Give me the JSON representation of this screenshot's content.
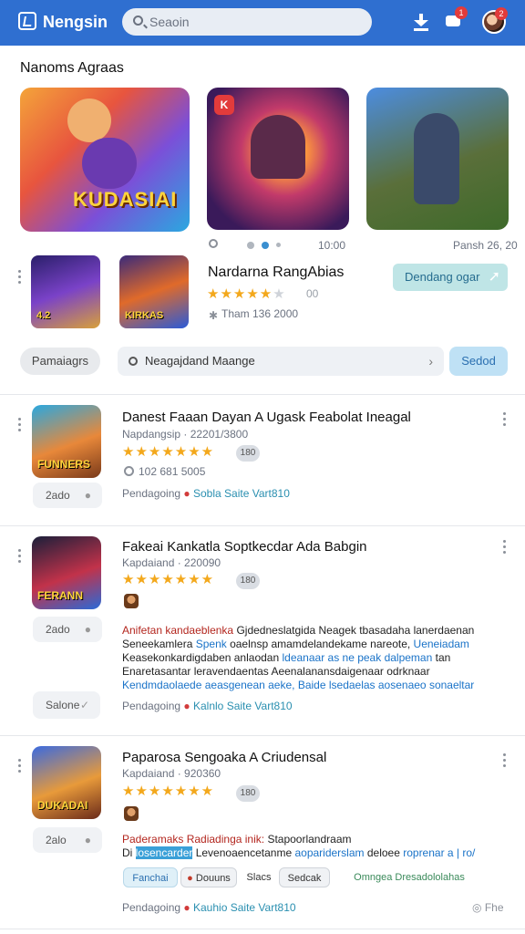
{
  "app": {
    "name": "Nengsin"
  },
  "search": {
    "placeholder": "Seaoin"
  },
  "header": {
    "notif_count": "1",
    "avatar_count": "2"
  },
  "colors": {
    "topbar": "#2f6fd0",
    "accent": "#2a8fb0",
    "star": "#f3a81c",
    "badge": "#e23b3b"
  },
  "section": {
    "title": "Nanoms Agraas"
  },
  "featured": [
    {
      "label": "KUDASIAI",
      "icon": "game-art"
    },
    {
      "label": "",
      "icon": "game-art",
      "badge": "K"
    },
    {
      "label": "",
      "icon": "game-art"
    }
  ],
  "carousel": {
    "left_meta": "10:00",
    "right_meta": "Pansh 26, 20"
  },
  "pick": {
    "title": "Nardarna RangAbias",
    "stars": 5,
    "score": "00",
    "sub": "Tham 136 2000",
    "button": "Dendang ogar",
    "mini_labels": [
      "4.2",
      "KIRKAS"
    ]
  },
  "filters": {
    "category_button": "Pamaiagrs",
    "filter_text": "Neagajdand Maange",
    "select_button": "Sedod"
  },
  "list": [
    {
      "title": "Danest Faaan Dayan A Ugask Feabolat Ineagal",
      "dev": "Napdangsip · 22201/3800",
      "rating": "180",
      "sub": "102 681 5005",
      "side_button": "2ado",
      "tags": {
        "lead": "Pendagoing",
        "a": "Sobla",
        "b": "Saite",
        "c": "Vart810"
      },
      "icon_label": "FUNNERS"
    },
    {
      "title": "Fakeai Kankatla Soptkecdar Ada Babgin",
      "dev": "Kapdaiand · 220090",
      "rating": "180",
      "side_button": "2ado",
      "side_button_2": "Salone",
      "description": {
        "line1_h": "Anifetan kandaeblenka",
        "line1": " Gjdedneslatgida Neagek tbasadaha lanerdaenan",
        "line2": "Seneekamlera ",
        "line2_lk": "Spenk",
        "line2_b": " oaelnsp amamdelandekame nareote, ",
        "line2_lk2": "Ueneiadam",
        "line3": "Keasekonkardigdaben anlaodan ",
        "line3_lk": "ldeanaar as ne peak dalpeman",
        "line3_b": " tan",
        "line4": "Enaretasantar leravendaentas Aeenalanansdaigenaar odrknaar",
        "line5_lk": "Kendmdaolaede aeasgenean aeke, Baide lsedaelas aosenaeo sonaeltar"
      },
      "tags": {
        "lead": "Pendagoing",
        "a": "Kalnlo",
        "b": "Saite",
        "c": "Vart810"
      },
      "icon_label": "FERANN"
    },
    {
      "title": "Paparosa Sengoaka A Criudensal",
      "dev": "Kapdaiand · 920360",
      "rating": "180",
      "side_button": "2alo",
      "description": {
        "line1_h": "Paderamaks Radiadinga",
        "line1_b": " inik: ",
        "line1": "Stapoorlandraam",
        "line2_pre": "Di ",
        "line2_hl": "losencarder",
        "line2": " Levenoaencetanme ",
        "line2_lk": "aopariderslam",
        "line2_b": " deloee ",
        "line2_lk2": "roprenar a | ro/"
      },
      "chips": {
        "a": "Fanchai",
        "b": "Douuns",
        "c": "Slacs",
        "d": "Sedcak",
        "e": "Omngea Dresadololahas"
      },
      "tags": {
        "lead": "Pendagoing",
        "a": "Kauhio",
        "b": "Saite",
        "c": "Vart810"
      },
      "footer_badge": "Fhe",
      "icon_label": "DUKADAI"
    }
  ]
}
